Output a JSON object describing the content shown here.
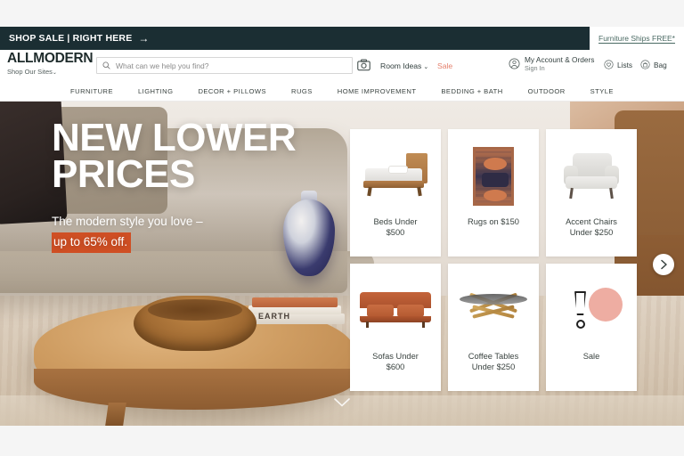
{
  "promo": {
    "banner_text": "SHOP SALE | RIGHT HERE",
    "banner_arrow": "→",
    "shipping_note": "Furniture Ships FREE*",
    "banner_bg": "#1b2e33"
  },
  "header": {
    "logo": "ALLMODERN",
    "shop_our_sites": "Shop Our Sites",
    "shop_our_sites_caret": "⌄",
    "search": {
      "placeholder": "What can we help you find?",
      "value": "",
      "icon": "search-icon"
    },
    "camera_icon": "camera-icon",
    "room_ideas": "Room Ideas",
    "room_ideas_caret": "⌄",
    "sale": "Sale",
    "sale_color": "#e5816d",
    "account": {
      "title": "My Account & Orders",
      "subtitle": "Sign In",
      "icon": "account-icon"
    },
    "lists": {
      "label": "Lists",
      "icon": "heart-icon"
    },
    "bag": {
      "label": "Bag",
      "icon": "bag-icon"
    }
  },
  "nav": {
    "items": [
      {
        "label": "FURNITURE"
      },
      {
        "label": "LIGHTING"
      },
      {
        "label": "DECOR + PILLOWS"
      },
      {
        "label": "RUGS"
      },
      {
        "label": "HOME IMPROVEMENT"
      },
      {
        "label": "BEDDING + BATH"
      },
      {
        "label": "OUTDOOR"
      },
      {
        "label": "STYLE"
      }
    ]
  },
  "hero": {
    "headline_line1": "NEW LOWER",
    "headline_line2": "PRICES",
    "sub_line1": "The modern style you love –",
    "sub_highlight": "up to 65% off.",
    "highlight_bg": "#cf4f24",
    "next_arrow_icon": "chevron-right-icon",
    "scroll_down_icon": "chevron-down-icon"
  },
  "cards": [
    {
      "label": "Beds Under $500",
      "line1": "Beds Under",
      "line2": "$500",
      "art": "bed-illustration"
    },
    {
      "label": "Rugs on $150",
      "line1": "Rugs on $150",
      "line2": "",
      "art": "rug-illustration"
    },
    {
      "label": "Accent Chairs Under $250",
      "line1": "Accent Chairs",
      "line2": "Under $250",
      "art": "accent-chair-illustration"
    },
    {
      "label": "Sofas Under $600",
      "line1": "Sofas Under",
      "line2": "$600",
      "art": "sofa-illustration"
    },
    {
      "label": "Coffee Tables Under $250",
      "line1": "Coffee Tables",
      "line2": "Under $250",
      "art": "coffee-table-illustration"
    },
    {
      "label": "Sale",
      "line1": "Sale",
      "line2": "",
      "art": "sale-illustration"
    }
  ],
  "scene": {
    "book_label": "EARTH"
  }
}
